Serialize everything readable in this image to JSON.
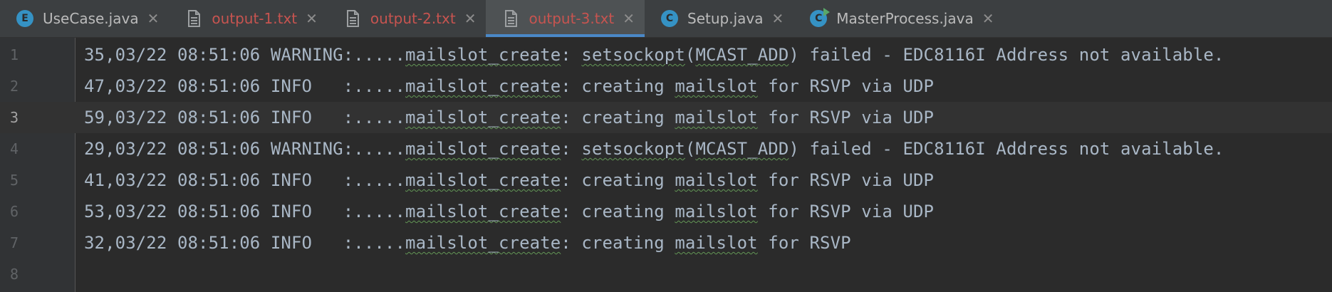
{
  "tabs": [
    {
      "label": "UseCase.java",
      "icon": "java-enum-icon",
      "icon_letter": "E",
      "icon_color": "#3592c4",
      "modified": false,
      "active": false
    },
    {
      "label": "output-1.txt",
      "icon": "text-file-icon",
      "modified": true,
      "active": false
    },
    {
      "label": "output-2.txt",
      "icon": "text-file-icon",
      "modified": true,
      "active": false
    },
    {
      "label": "output-3.txt",
      "icon": "text-file-icon",
      "modified": true,
      "active": true
    },
    {
      "label": "Setup.java",
      "icon": "java-class-icon",
      "icon_letter": "C",
      "icon_color": "#3592c4",
      "modified": false,
      "active": false
    },
    {
      "label": "MasterProcess.java",
      "icon": "java-runnable-class-icon",
      "icon_letter": "C",
      "icon_color": "#3592c4",
      "modified": false,
      "active": false
    }
  ],
  "close_glyph": "✕",
  "editor": {
    "current_line": 3,
    "lines": [
      {
        "number": "1",
        "segments": [
          {
            "text": "35,03/22 08:51:06 WARNING:.....",
            "squiggle": false
          },
          {
            "text": "mailslot_create",
            "squiggle": true
          },
          {
            "text": ": ",
            "squiggle": false
          },
          {
            "text": "setsockopt",
            "squiggle": true
          },
          {
            "text": "(",
            "squiggle": false
          },
          {
            "text": "MCAST_ADD",
            "squiggle": true
          },
          {
            "text": ") failed - EDC8116I Address not available.",
            "squiggle": false
          }
        ]
      },
      {
        "number": "2",
        "segments": [
          {
            "text": "47,03/22 08:51:06 INFO   :.....",
            "squiggle": false
          },
          {
            "text": "mailslot_create",
            "squiggle": true
          },
          {
            "text": ": creating ",
            "squiggle": false
          },
          {
            "text": "mailslot",
            "squiggle": true
          },
          {
            "text": " for RSVP via UDP",
            "squiggle": false
          }
        ]
      },
      {
        "number": "3",
        "segments": [
          {
            "text": "59,03/22 08:51:06 INFO   :.....",
            "squiggle": false
          },
          {
            "text": "mailslot_create",
            "squiggle": true
          },
          {
            "text": ": creating ",
            "squiggle": false
          },
          {
            "text": "mailslot",
            "squiggle": true
          },
          {
            "text": " for RSVP via UDP",
            "squiggle": false
          }
        ]
      },
      {
        "number": "4",
        "segments": [
          {
            "text": "29,03/22 08:51:06 WARNING:.....",
            "squiggle": false
          },
          {
            "text": "mailslot_create",
            "squiggle": true
          },
          {
            "text": ": ",
            "squiggle": false
          },
          {
            "text": "setsockopt",
            "squiggle": true
          },
          {
            "text": "(",
            "squiggle": false
          },
          {
            "text": "MCAST_ADD",
            "squiggle": true
          },
          {
            "text": ") failed - EDC8116I Address not available.",
            "squiggle": false
          }
        ]
      },
      {
        "number": "5",
        "segments": [
          {
            "text": "41,03/22 08:51:06 INFO   :.....",
            "squiggle": false
          },
          {
            "text": "mailslot_create",
            "squiggle": true
          },
          {
            "text": ": creating ",
            "squiggle": false
          },
          {
            "text": "mailslot",
            "squiggle": true
          },
          {
            "text": " for RSVP via UDP",
            "squiggle": false
          }
        ]
      },
      {
        "number": "6",
        "segments": [
          {
            "text": "53,03/22 08:51:06 INFO   :.....",
            "squiggle": false
          },
          {
            "text": "mailslot_create",
            "squiggle": true
          },
          {
            "text": ": creating ",
            "squiggle": false
          },
          {
            "text": "mailslot",
            "squiggle": true
          },
          {
            "text": " for RSVP via UDP",
            "squiggle": false
          }
        ]
      },
      {
        "number": "7",
        "segments": [
          {
            "text": "32,03/22 08:51:06 INFO   :.....",
            "squiggle": false
          },
          {
            "text": "mailslot_create",
            "squiggle": true
          },
          {
            "text": ": creating ",
            "squiggle": false
          },
          {
            "text": "mailslot",
            "squiggle": true
          },
          {
            "text": " for RSVP",
            "squiggle": false
          }
        ]
      },
      {
        "number": "8",
        "segments": []
      }
    ]
  }
}
